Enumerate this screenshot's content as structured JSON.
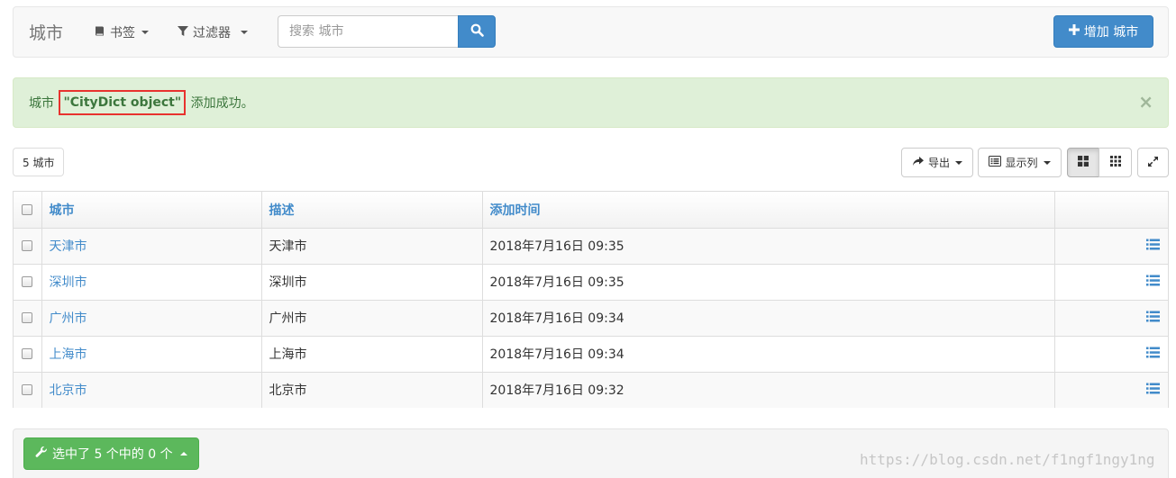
{
  "navbar": {
    "brand": "城市",
    "bookmarks_label": "书签",
    "filter_label": "过滤器",
    "search_placeholder": "搜索 城市",
    "add_button_label": "增加 城市"
  },
  "alert": {
    "prefix": "城市 ",
    "object_name": "\"CityDict object\"",
    "suffix": " 添加成功。",
    "close_symbol": "×"
  },
  "toolbar": {
    "count_label": "5 城市",
    "export_label": "导出",
    "columns_label": "显示列"
  },
  "table": {
    "headers": [
      "城市",
      "描述",
      "添加时间"
    ],
    "rows": [
      {
        "name": "天津市",
        "desc": "天津市",
        "time": "2018年7月16日 09:35"
      },
      {
        "name": "深圳市",
        "desc": "深圳市",
        "time": "2018年7月16日 09:35"
      },
      {
        "name": "广州市",
        "desc": "广州市",
        "time": "2018年7月16日 09:34"
      },
      {
        "name": "上海市",
        "desc": "上海市",
        "time": "2018年7月16日 09:34"
      },
      {
        "name": "北京市",
        "desc": "北京市",
        "time": "2018年7月16日 09:32"
      }
    ]
  },
  "footer": {
    "batch_label": "选中了 5 个中的 0 个"
  },
  "watermark": "https://blog.csdn.net/f1ngf1ngy1ng",
  "colors": {
    "primary": "#428bca",
    "success": "#5cb85c",
    "alert_bg": "#dff0d8",
    "alert_text": "#3c763d",
    "highlight": "#e8322e"
  },
  "icons": [
    "book-icon",
    "filter-icon",
    "search-icon",
    "plus-icon",
    "share-icon",
    "list-alt-icon",
    "th-large-icon",
    "th-icon",
    "fullscreen-icon",
    "list-icon",
    "wrench-icon"
  ]
}
